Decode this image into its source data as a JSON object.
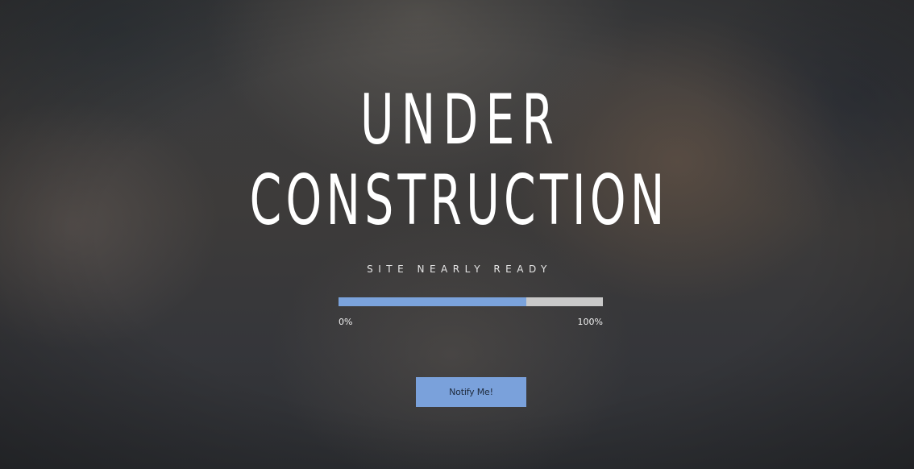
{
  "hero": {
    "title_line_1": "UNDER",
    "title_line_2": "CONSTRUCTION",
    "subtitle": "SITE NEARLY READY"
  },
  "progress": {
    "value_fraction": 0.71,
    "min_label": "0%",
    "max_label": "100%",
    "fill_color": "#7ba3dc",
    "track_color": "#c9c9c9"
  },
  "notify_button": {
    "label": "Notify Me!",
    "color": "#7aa1db"
  }
}
